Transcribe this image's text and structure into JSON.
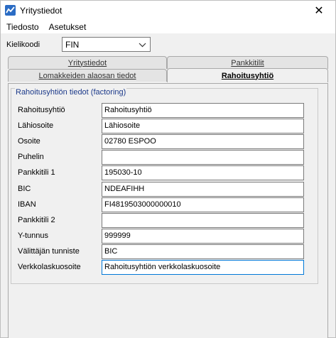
{
  "window": {
    "title": "Yritystiedot",
    "close_glyph": "✕"
  },
  "menu": {
    "items": [
      "Tiedosto",
      "Asetukset"
    ]
  },
  "language": {
    "label": "Kielikoodi",
    "value": "FIN"
  },
  "tabs": {
    "row1": [
      "Yritystiedot",
      "Pankkitilit"
    ],
    "row2": [
      "Lomakkeiden alaosan tiedot",
      "Rahoitusyhtiö"
    ],
    "active": "Rahoitusyhtiö"
  },
  "group": {
    "title": "Rahoitusyhtiön tiedot (factoring)"
  },
  "fields": [
    {
      "label": "Rahoitusyhtiö",
      "value": "Rahoitusyhtiö"
    },
    {
      "label": "Lähiosoite",
      "value": "Lähiosoite"
    },
    {
      "label": "Osoite",
      "value": "02780 ESPOO"
    },
    {
      "label": "Puhelin",
      "value": ""
    },
    {
      "label": "Pankkitili 1",
      "value": "195030-10"
    },
    {
      "label": "BIC",
      "value": "NDEAFIHH"
    },
    {
      "label": "IBAN",
      "value": "FI4819503000000010"
    },
    {
      "label": "Pankkitili 2",
      "value": ""
    },
    {
      "label": "Y-tunnus",
      "value": "999999"
    },
    {
      "label": "Välittäjän tunniste",
      "value": "BIC"
    },
    {
      "label": "Verkkolaskuosoite",
      "value": "Rahoitusyhtiön verkkolaskuosoite"
    }
  ],
  "colors": {
    "accent": "#0078d7",
    "group_title": "#1c3a8a"
  }
}
